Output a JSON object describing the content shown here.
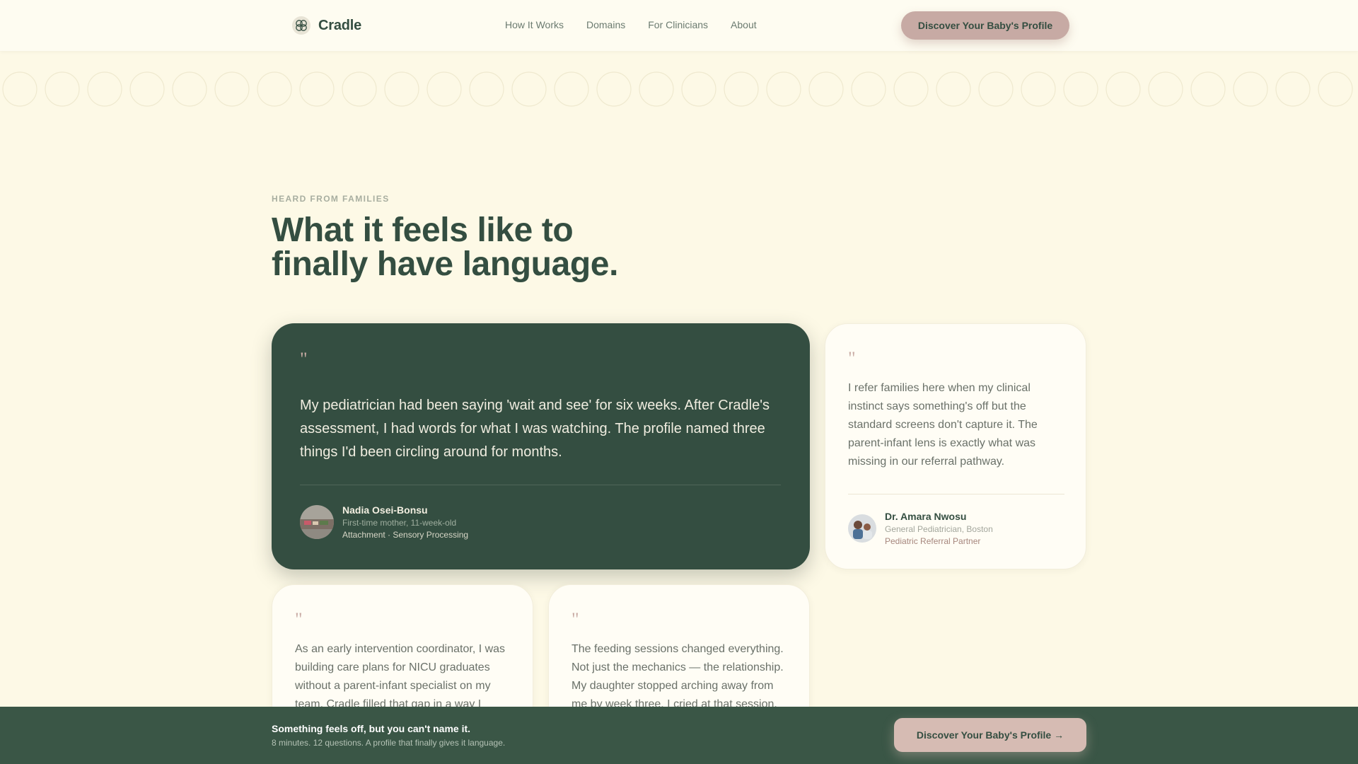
{
  "nav": {
    "brand": "Cradle",
    "logo_icon": "flower-logo-icon",
    "links": [
      "How It Works",
      "Domains",
      "For Clinicians",
      "About"
    ],
    "cta": "Discover Your Baby's Profile"
  },
  "section": {
    "eyebrow": "HEARD FROM FAMILIES",
    "heading_line1": "What it feels like to",
    "heading_line2": "finally have language."
  },
  "testimonials": {
    "featured": {
      "quote_mark": "\"",
      "text": "My pediatrician had been saying 'wait and see' for six weeks. After Cradle's assessment, I had words for what I was watching. The profile named three things I'd been circling around for months.",
      "name": "Nadia Osei-Bonsu",
      "role": "First-time mother, 11-week-old",
      "tags": "Attachment · Sensory Processing"
    },
    "clinician": {
      "quote_mark": "\"",
      "text": "I refer families here when my clinical instinct says something's off but the standard screens don't capture it. The parent-infant lens is exactly what was missing in our referral pathway.",
      "name": "Dr. Amara Nwosu",
      "role": "General Pediatrician, Boston",
      "tags": "Pediatric Referral Partner"
    },
    "coordinator": {
      "quote_mark": "\"",
      "text": "As an early intervention coordinator, I was building care plans for NICU graduates without a parent-infant specialist on my team. Cradle filled that gap in a way I"
    },
    "parent2": {
      "quote_mark": "\"",
      "text": "The feeding sessions changed everything. Not just the mechanics — the relationship. My daughter stopped arching away from me by week three. I cried at that session."
    }
  },
  "bottom_bar": {
    "title": "Something feels off, but you can't name it.",
    "subtitle": "8 minutes. 12 questions. A profile that finally gives it language.",
    "cta": "Discover Your Baby's Profile →"
  },
  "colors": {
    "background": "#fdf9e6",
    "primary_green": "#344e41",
    "accent_rose": "#c7aaa4"
  }
}
